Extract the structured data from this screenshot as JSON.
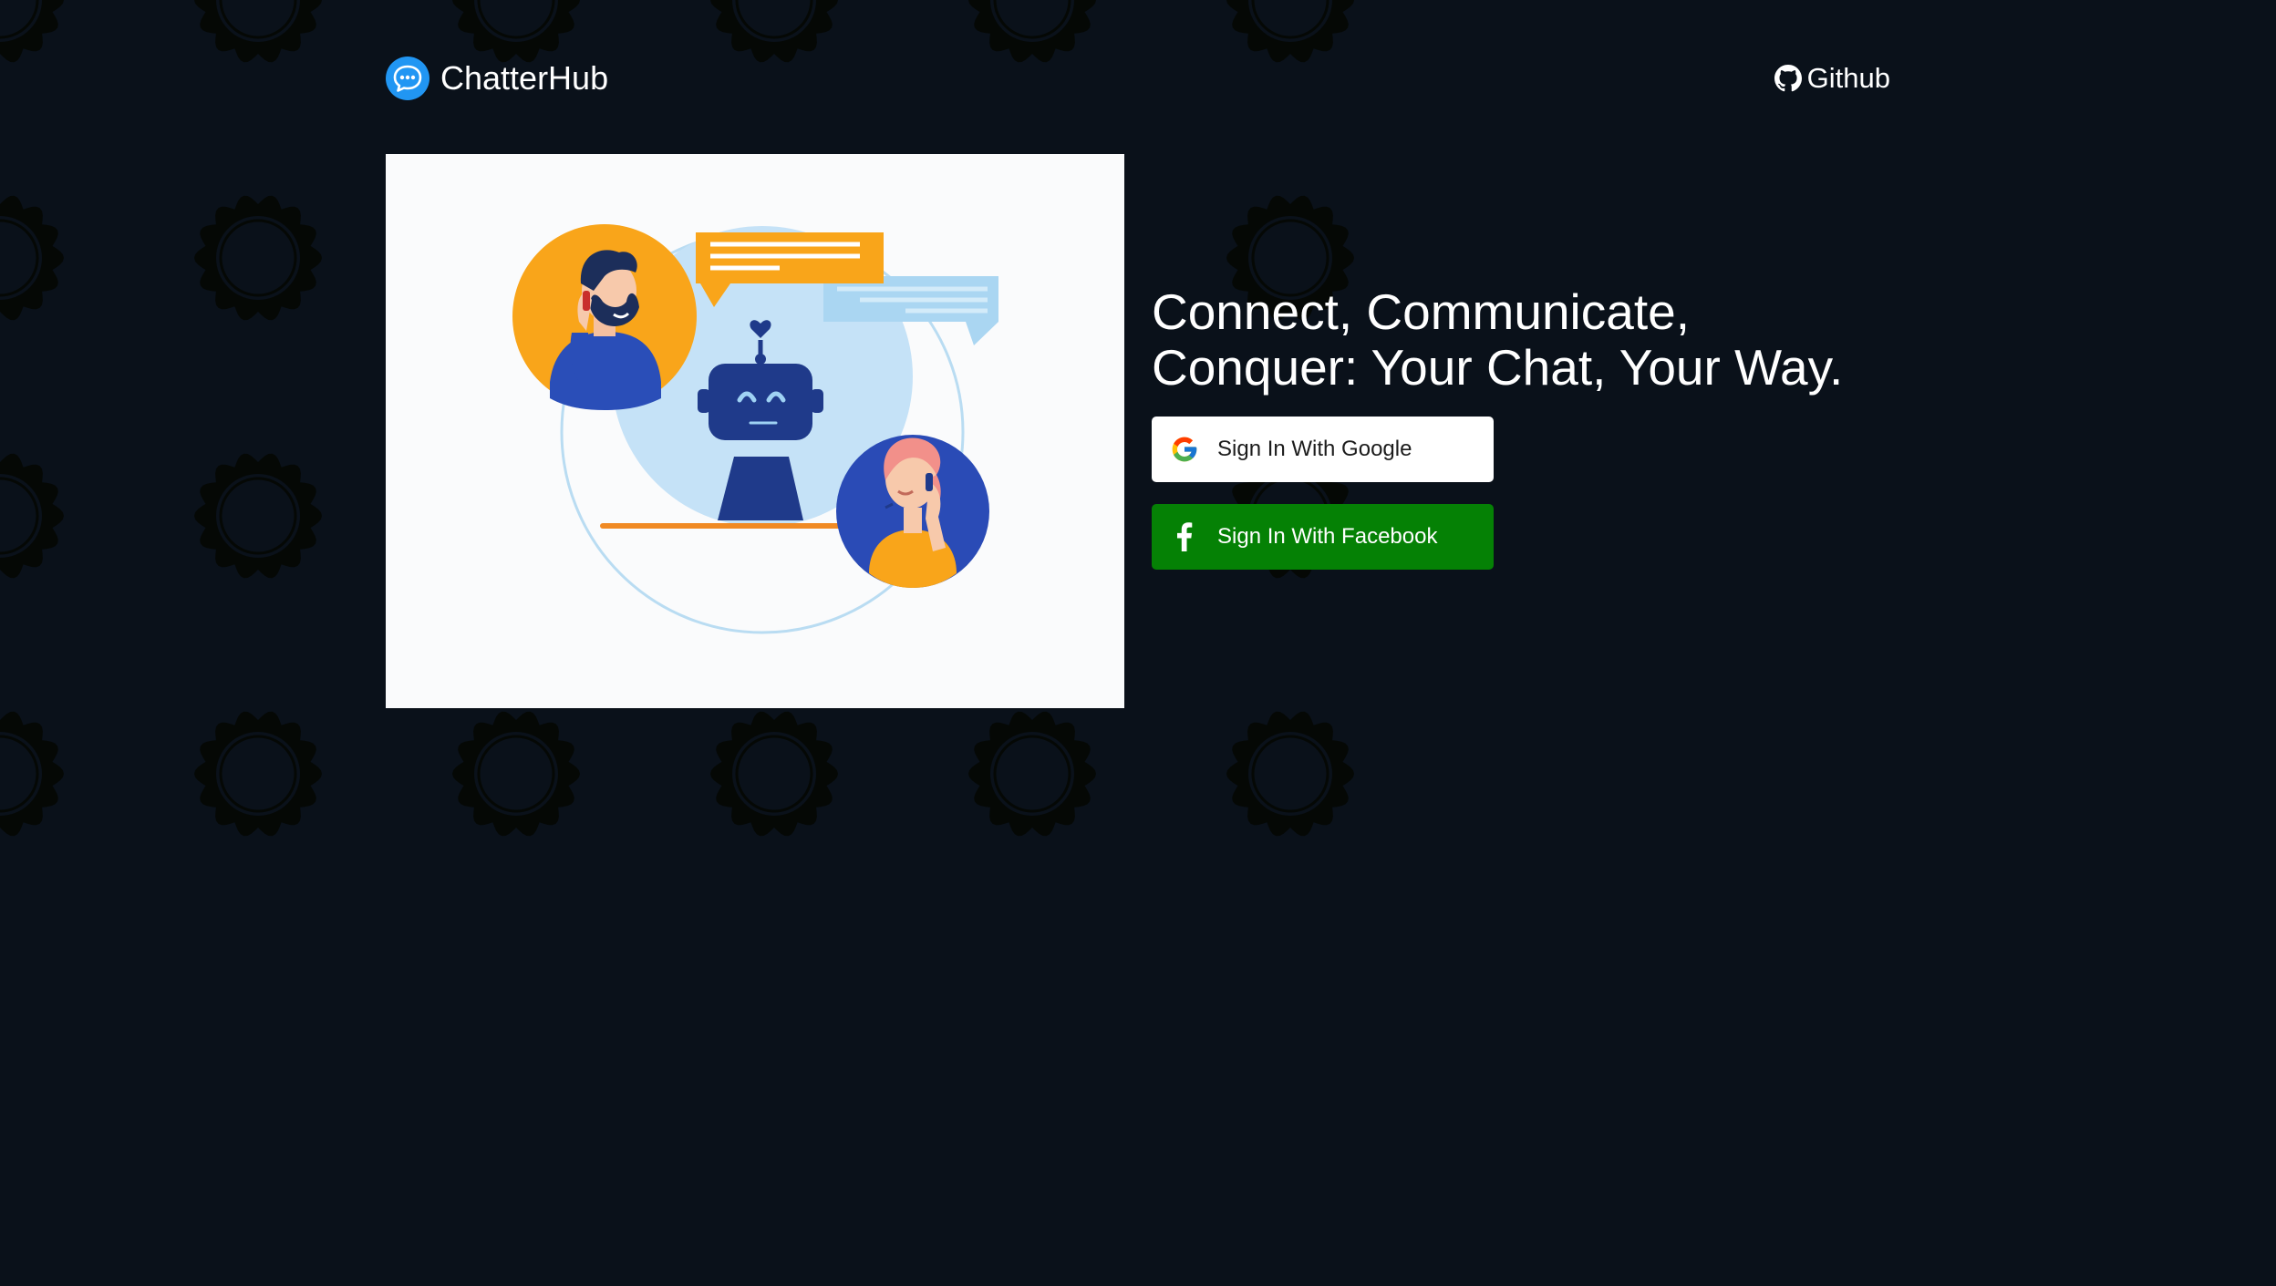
{
  "colors": {
    "page_background": "#0a111a",
    "pattern_ring": "#050805",
    "brand_blue": "#2196f3",
    "facebook_button": "#058105",
    "google_button": "#ffffff",
    "illustration_orange": "#f9a51a",
    "illustration_navy": "#1f3a8a",
    "illustration_light_blue": "#c5e2f7"
  },
  "header": {
    "brand": {
      "name": "ChatterHub",
      "icon": "chat-bubble-icon"
    },
    "github": {
      "label": "Github",
      "icon": "github-icon"
    }
  },
  "hero": {
    "illustration": "customer-support-chat-illustration",
    "headline": "Connect, Communicate, Conquer: Your Chat, Your Way."
  },
  "auth": {
    "google": {
      "label": "Sign In With Google",
      "icon": "google-icon"
    },
    "facebook": {
      "label": "Sign In With Facebook",
      "icon": "facebook-icon"
    }
  }
}
